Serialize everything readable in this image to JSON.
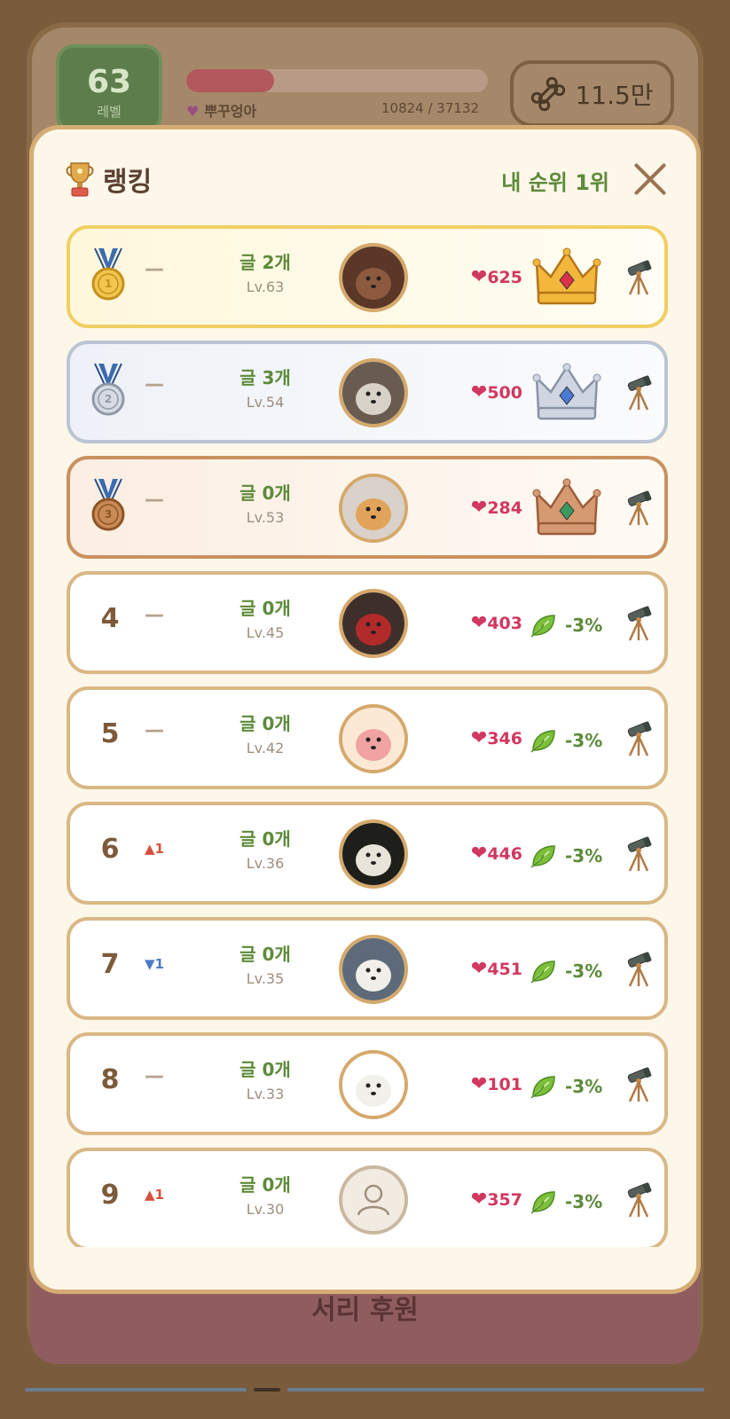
{
  "background": {
    "level_number": "63",
    "level_label": "레벨",
    "user_name": "뿌꾸엉아",
    "xp": "10824 / 37132",
    "xp_progress": 0.29,
    "currency": "11.5만",
    "bottom_button": "서리 후원"
  },
  "modal": {
    "title": "랭킹",
    "my_rank": "내 순위 1위",
    "rows": [
      {
        "rank": "1",
        "medal": "gold",
        "change": "flat",
        "change_text": "—",
        "posts": "글 2개",
        "level": "Lv.63",
        "avatar": "brown-poodle-dog",
        "hearts": "625",
        "badge": "crown",
        "crown_color": "gold"
      },
      {
        "rank": "2",
        "medal": "silver",
        "change": "flat",
        "change_text": "—",
        "posts": "글 3개",
        "level": "Lv.54",
        "avatar": "white-dog-bunny-ears",
        "hearts": "500",
        "badge": "crown",
        "crown_color": "silver"
      },
      {
        "rank": "3",
        "medal": "bronze",
        "change": "flat",
        "change_text": "—",
        "posts": "글 0개",
        "level": "Lv.53",
        "avatar": "pomeranian-dog",
        "hearts": "284",
        "badge": "crown",
        "crown_color": "bronze"
      },
      {
        "rank": "4",
        "medal": "",
        "change": "flat",
        "change_text": "—",
        "posts": "글 0개",
        "level": "Lv.45",
        "avatar": "dog-in-red-hat",
        "hearts": "403",
        "badge": "leaf",
        "badge_text": "-3%"
      },
      {
        "rank": "5",
        "medal": "",
        "change": "flat",
        "change_text": "—",
        "posts": "글 0개",
        "level": "Lv.42",
        "avatar": "rice-bowl",
        "hearts": "346",
        "badge": "leaf",
        "badge_text": "-3%"
      },
      {
        "rank": "6",
        "medal": "",
        "change": "up",
        "change_text": "▲1",
        "posts": "글 0개",
        "level": "Lv.36",
        "avatar": "moomin-figure",
        "hearts": "446",
        "badge": "leaf",
        "badge_text": "-3%"
      },
      {
        "rank": "7",
        "medal": "",
        "change": "down",
        "change_text": "▼1",
        "posts": "글 0개",
        "level": "Lv.35",
        "avatar": "white-dog-with-person",
        "hearts": "451",
        "badge": "leaf",
        "badge_text": "-3%"
      },
      {
        "rank": "8",
        "medal": "",
        "change": "flat",
        "change_text": "—",
        "posts": "글 0개",
        "level": "Lv.33",
        "avatar": "white-fluffy-dog",
        "hearts": "101",
        "badge": "leaf",
        "badge_text": "-3%"
      },
      {
        "rank": "9",
        "medal": "",
        "change": "up",
        "change_text": "▲1",
        "posts": "글 0개",
        "level": "Lv.30",
        "avatar": "default-user",
        "hearts": "357",
        "badge": "leaf",
        "badge_text": "-3%"
      }
    ]
  },
  "colors": {
    "accent_green": "#5d8a3a",
    "heart_red": "#d1385f",
    "modal_bg": "#fdf7ea",
    "row_border": "#d9b886",
    "up_red": "#d7503d",
    "down_blue": "#4d79c3"
  },
  "icons": {
    "trophy": "trophy-icon",
    "close": "close-icon",
    "heart": "heart-icon",
    "telescope": "telescope-icon",
    "leaf": "leaf-icon",
    "crown": "crown-icon",
    "bone": "bone-icon"
  }
}
